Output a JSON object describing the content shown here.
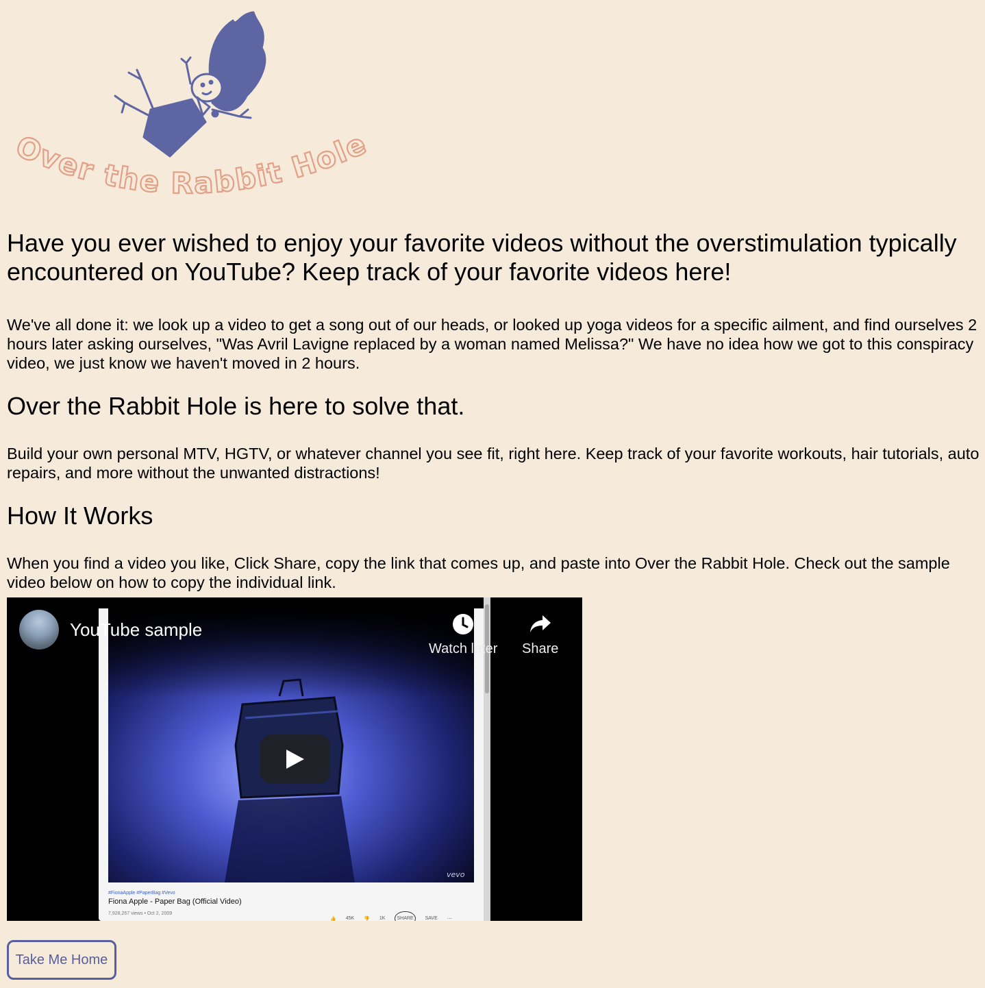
{
  "logo": {
    "text": "Over the Rabbit Hole",
    "colors": {
      "figure": "#5d66a3",
      "letters": "#e2a086"
    }
  },
  "content": {
    "headline": "Have you ever wished to enjoy your favorite videos without the overstimulation typically encountered on YouTube? Keep track of your favorite videos here!",
    "intro": "We've all done it: we look up a video to get a song out of our heads, or looked up yoga videos for a specific ailment, and find ourselves 2 hours later asking ourselves, \"Was Avril Lavigne replaced by a woman named Melissa?\" We have no idea how we got to this conspiracy video, we just know we haven't moved in 2 hours.",
    "solve_heading": "Over the Rabbit Hole is here to solve that.",
    "solve_text": "Build your own personal MTV, HGTV, or whatever channel you see fit, right here. Keep track of your favorite workouts, hair tutorials, auto repairs, and more without the unwanted distractions!",
    "how_heading": "How It Works",
    "how_text": "When you find a video you like, Click Share, copy the link that comes up, and paste into Over the Rabbit Hole. Check out the sample video below on how to copy the individual link."
  },
  "video": {
    "title": "YouTube sample",
    "watch_later_label": "Watch later",
    "share_label": "Share",
    "inner": {
      "tags": "#FionaApple #PaperBag #Vevo",
      "title": "Fiona Apple - Paper Bag (Official Video)",
      "views": "7,928,267 views • Oct 2, 2009",
      "likes": "45K",
      "dislikes": "1K",
      "share": "SHARE",
      "save": "SAVE",
      "watermark": "vevo"
    }
  },
  "home_button": {
    "label": "Take Me Home"
  }
}
